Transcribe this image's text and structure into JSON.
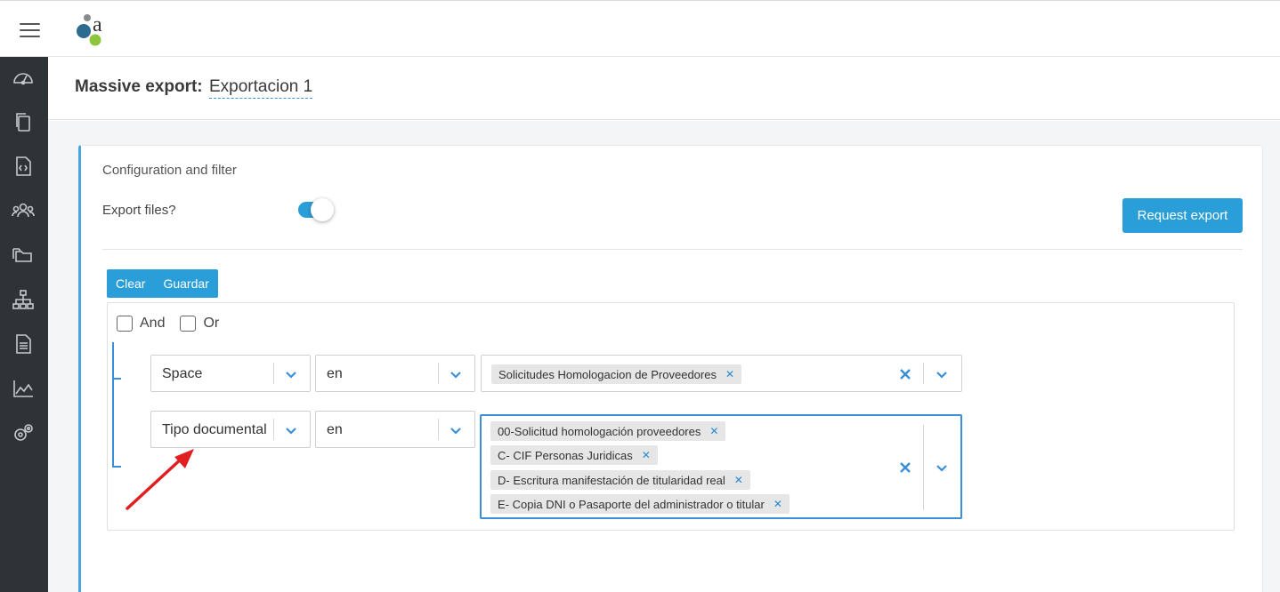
{
  "header": {
    "title_prefix": "Massive export:",
    "title_value": "Exportacion 1"
  },
  "sidebar": {
    "items": [
      {
        "icon": "dashboard-icon"
      },
      {
        "icon": "documents-copy-icon"
      },
      {
        "icon": "code-file-icon"
      },
      {
        "icon": "users-icon"
      },
      {
        "icon": "folders-icon"
      },
      {
        "icon": "hierarchy-icon"
      },
      {
        "icon": "document-icon"
      },
      {
        "icon": "area-chart-icon"
      },
      {
        "icon": "settings-gears-icon"
      }
    ]
  },
  "config": {
    "section_title": "Configuration and filter",
    "export_files_label": "Export files?",
    "export_files_enabled": true,
    "request_export_label": "Request export"
  },
  "query": {
    "clear_label": "Clear",
    "save_label": "Guardar",
    "and_label": "And",
    "or_label": "Or",
    "rules": [
      {
        "field": "Space",
        "operator": "en",
        "values": [
          "Solicitudes Homologacion de Proveedores"
        ]
      },
      {
        "field": "Tipo documental",
        "operator": "en",
        "values": [
          "00-Solicitud homologación proveedores",
          "C- CIF Personas Juridicas",
          "D- Escritura manifestación de titularidad real",
          "E- Copia DNI o Pasaporte del administrador o titular"
        ]
      }
    ]
  },
  "colors": {
    "accent": "#2a9ed9",
    "sidebar_bg": "#2f3338",
    "annotation_arrow": "#e02020"
  }
}
